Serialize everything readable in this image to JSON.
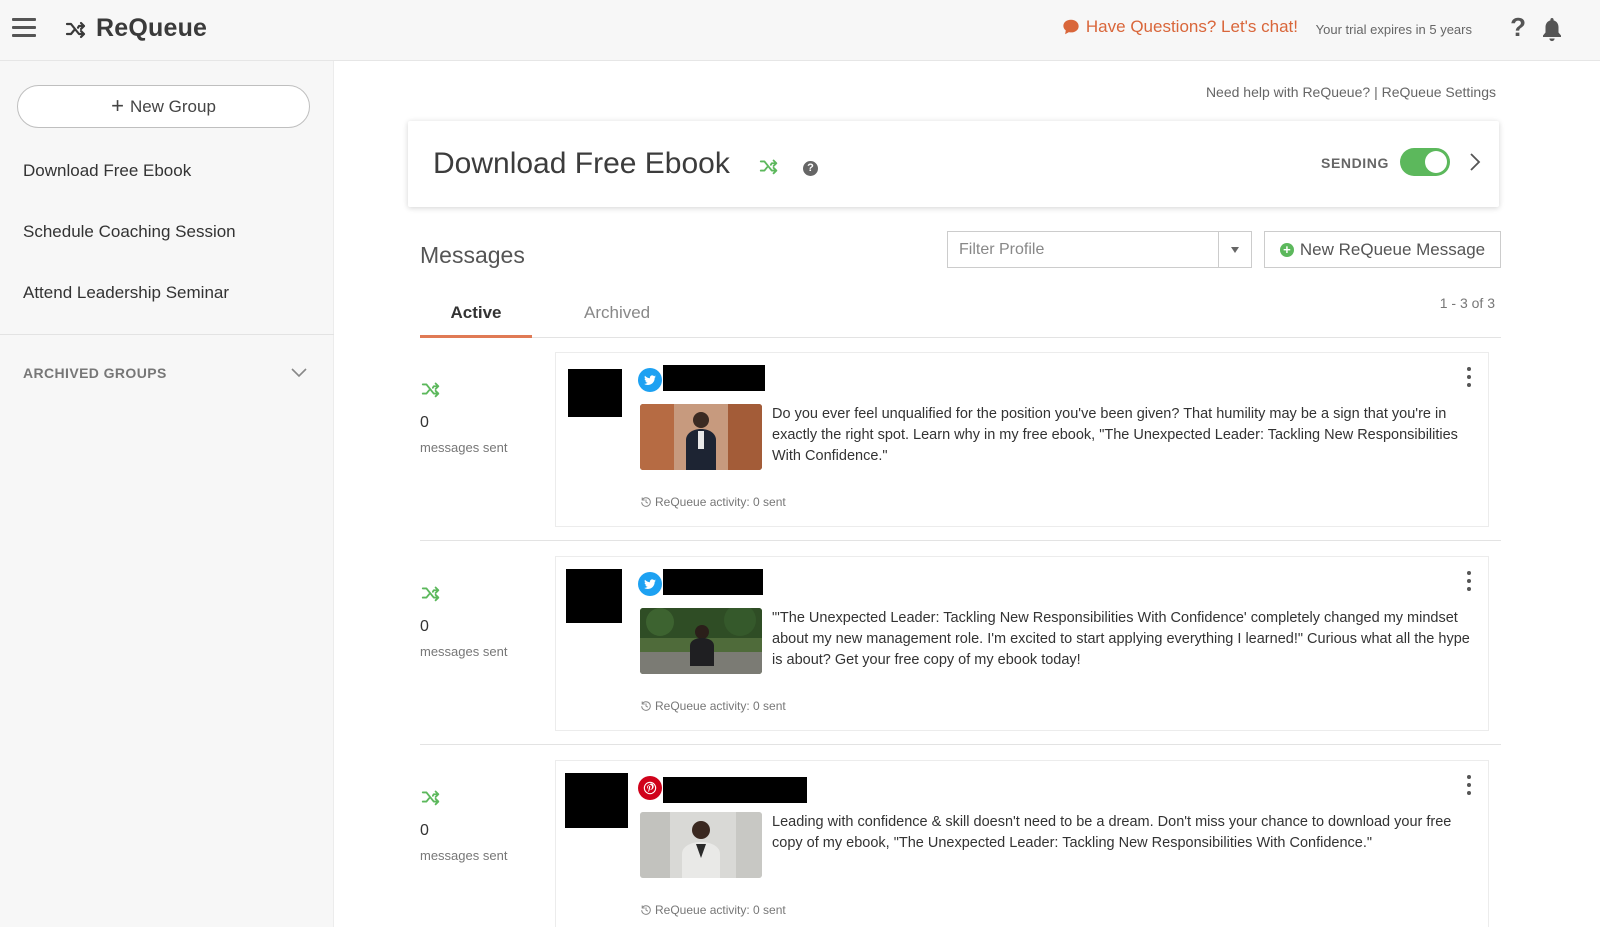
{
  "app": {
    "title": "ReQueue"
  },
  "header": {
    "chat_label": "Have Questions? Let's chat!",
    "trial_text": "Your trial expires in 5 years",
    "help_glyph": "?"
  },
  "sidebar": {
    "new_group_label": "New Group",
    "groups": [
      {
        "label": "Download Free Ebook"
      },
      {
        "label": "Schedule Coaching Session"
      },
      {
        "label": "Attend Leadership Seminar"
      }
    ],
    "archived_label": "ARCHIVED GROUPS"
  },
  "main": {
    "help_link": "Need help with ReQueue?",
    "link_separator": "|",
    "settings_link": "ReQueue Settings",
    "group_title": "Download Free Ebook",
    "sending_label": "SENDING",
    "sending_on": true,
    "messages_title": "Messages",
    "filter_placeholder": "Filter Profile",
    "new_message_label": "New ReQueue Message",
    "tabs": [
      {
        "label": "Active",
        "active": true
      },
      {
        "label": "Archived",
        "active": false
      }
    ],
    "pager": "1 - 3 of 3",
    "messages": [
      {
        "count": "0",
        "count_label": "messages sent",
        "network": "twitter",
        "text": "Do you ever feel unqualified for the position you've been given? That humility may be a sign that you're in exactly the right spot. Learn why in my free ebook, \"The Unexpected Leader: Tackling New Responsibilities With Confidence.\"",
        "activity": "ReQueue activity: 0 sent"
      },
      {
        "count": "0",
        "count_label": "messages sent",
        "network": "twitter",
        "text": "\"'The Unexpected Leader: Tackling New Responsibilities With Confidence' completely changed my mindset about my new management role. I'm excited to start applying everything I learned!\" Curious what all the hype is about? Get your free copy of my ebook today!",
        "activity": "ReQueue activity: 0 sent"
      },
      {
        "count": "0",
        "count_label": "messages sent",
        "network": "pinterest",
        "text": "Leading with confidence & skill doesn't need to be a dream. Don't miss your chance to download your free copy of my ebook, \"The Unexpected Leader: Tackling New Responsibilities With Confidence.\"",
        "activity": "ReQueue activity: 0 sent"
      }
    ]
  },
  "colors": {
    "accent": "#e07a55",
    "chat": "#d9663a",
    "shuffle_green": "#5cb85c",
    "twitter": "#1da1f2",
    "pinterest": "#d0021b"
  }
}
